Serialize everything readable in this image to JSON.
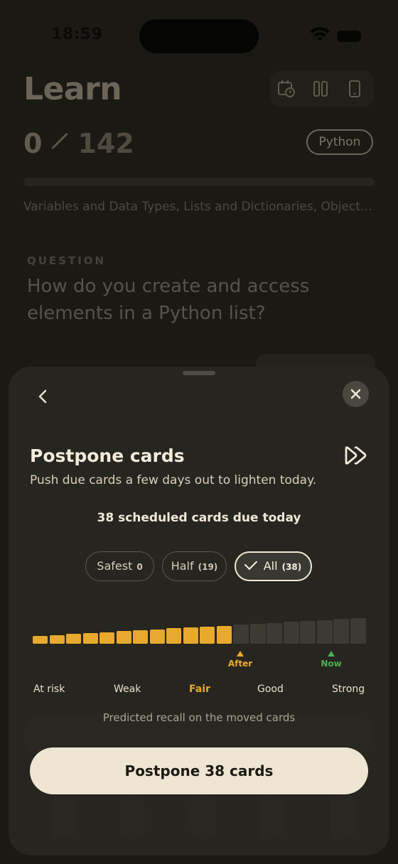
{
  "status_bar": {
    "time": "18:59"
  },
  "screen": {
    "title": "Learn",
    "progress_current": "0",
    "progress_total": "142",
    "progress_fraction": 0,
    "tag": "Python",
    "topics": "Variables and Data Types, Lists and Dictionaries, Objects and Classes",
    "question_label": "QUESTION",
    "question_text": "How do you create and access elements in a Python list?",
    "toolbar_icons": [
      "calendar-clock-icon",
      "columns-icon",
      "phone-icon"
    ]
  },
  "sheet": {
    "title": "Postpone cards",
    "subtitle": "Push due cards a few days out to lighten today.",
    "due_text": "38 scheduled cards due today",
    "options": [
      {
        "label": "Safest",
        "count": "0",
        "selected": false
      },
      {
        "label": "Half",
        "count": "(19)",
        "selected": false
      },
      {
        "label": "All",
        "count": "(38)",
        "selected": true
      }
    ],
    "recall_bars": {
      "total": 20,
      "highlighted": 12
    },
    "markers": {
      "after": "After",
      "now": "Now"
    },
    "levels": [
      "At risk",
      "Weak",
      "Fair",
      "Good",
      "Strong"
    ],
    "caption": "Predicted recall on the moved cards",
    "cta": "Postpone 38 cards",
    "colors": {
      "accent": "#e9a92e",
      "now": "#4caf50",
      "cta_bg": "#eee5d2"
    }
  }
}
